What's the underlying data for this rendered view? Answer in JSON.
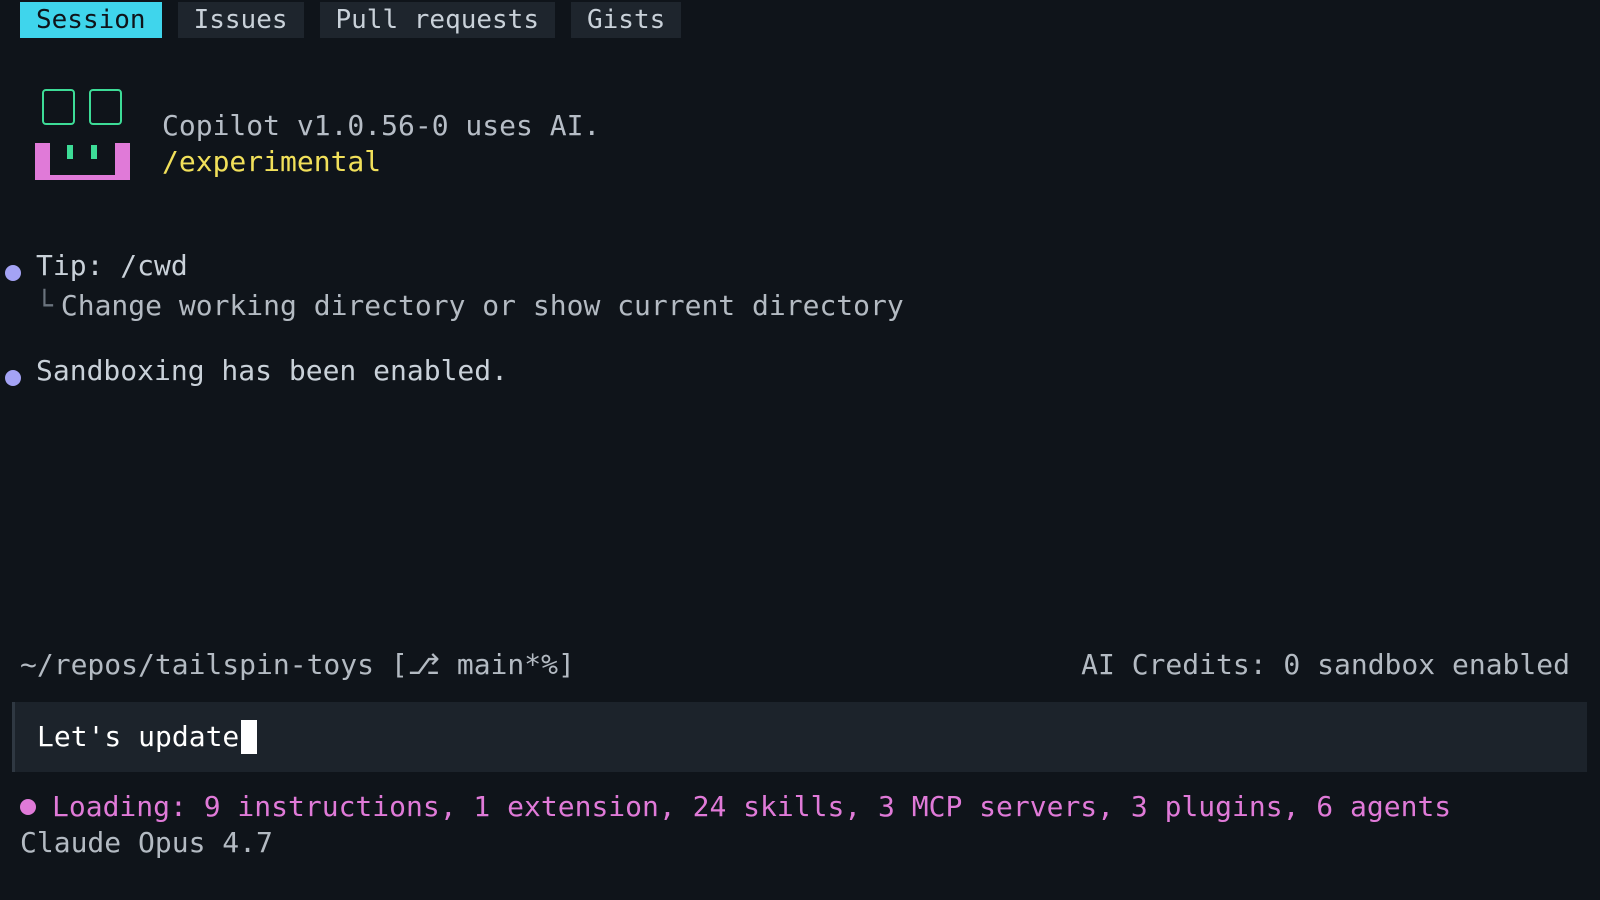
{
  "tabs": [
    {
      "label": "Session",
      "active": true
    },
    {
      "label": "Issues",
      "active": false
    },
    {
      "label": "Pull requests",
      "active": false
    },
    {
      "label": "Gists",
      "active": false
    }
  ],
  "header": {
    "line1": "Copilot v1.0.56-0 uses AI.",
    "line2": "/experimental"
  },
  "messages": {
    "tip_title": "Tip: /cwd",
    "tip_detail": "Change working directory or show current directory",
    "sandbox": "Sandboxing has been enabled."
  },
  "status": {
    "path": "~/repos/tailspin-toys [⎇ main*%]",
    "credits": "AI Credits: 0 sandbox enabled"
  },
  "prompt": {
    "value": "Let's update"
  },
  "footer": {
    "loading": "Loading: 9 instructions, 1 extension, 24 skills, 3 MCP servers, 3 plugins, 6 agents",
    "model": "Claude Opus 4.7"
  },
  "colors": {
    "background": "#0f141a",
    "active_tab": "#3fd5ec",
    "experimental": "#f1e05a",
    "bullet": "#a4a3f5",
    "loading": "#e07ad8"
  }
}
